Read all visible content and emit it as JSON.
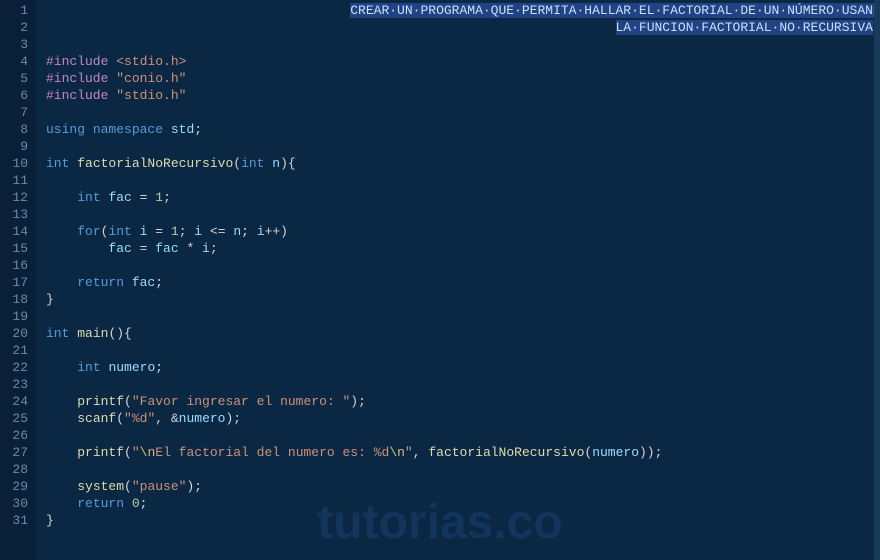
{
  "line_numbers": [
    "1",
    "2",
    "3",
    "4",
    "5",
    "6",
    "7",
    "8",
    "9",
    "10",
    "11",
    "12",
    "13",
    "14",
    "15",
    "16",
    "17",
    "18",
    "19",
    "20",
    "21",
    "22",
    "23",
    "24",
    "25",
    "26",
    "27",
    "28",
    "29",
    "30",
    "31"
  ],
  "comment": {
    "line1_prefix": "                                       ",
    "line1": "CREAR·UN·PROGRAMA·QUE·PERMITA·HALLAR·EL·FACTORIAL·DE·UN·NÚMERO·USANDO",
    "line2_prefix": "                                                                         ",
    "line2": "LA·FUNCION·FACTORIAL·NO·RECURSIVA"
  },
  "code": {
    "l4_inc": "#include",
    "l4_hdr": "<stdio.h>",
    "l5_inc": "#include",
    "l5_hdr": "\"conio.h\"",
    "l6_inc": "#include",
    "l6_hdr": "\"stdio.h\"",
    "l8_using": "using",
    "l8_ns": "namespace",
    "l8_std": "std",
    "l8_semi": ";",
    "l10_int": "int",
    "l10_fn": "factorialNoRecursivo",
    "l10_lp": "(",
    "l10_int2": "int",
    "l10_n": "n",
    "l10_rp": "){",
    "l12_indent": "    ",
    "l12_int": "int",
    "l12_fac": "fac",
    "l12_eq": " = ",
    "l12_one": "1",
    "l12_semi": ";",
    "l14_indent": "    ",
    "l14_for": "for",
    "l14_lp": "(",
    "l14_int": "int",
    "l14_i": "i",
    "l14_eq": " = ",
    "l14_one": "1",
    "l14_semi1": "; ",
    "l14_i2": "i",
    "l14_le": " <= ",
    "l14_n": "n",
    "l14_semi2": "; ",
    "l14_i3": "i",
    "l14_inc": "++)",
    "l15_indent": "        ",
    "l15_fac": "fac",
    "l15_eq": " = ",
    "l15_fac2": "fac",
    "l15_mul": " * ",
    "l15_i": "i",
    "l15_semi": ";",
    "l17_indent": "    ",
    "l17_ret": "return",
    "l17_fac": " fac",
    "l17_semi": ";",
    "l18_close": "}",
    "l20_int": "int",
    "l20_main": "main",
    "l20_paren": "(){",
    "l22_indent": "    ",
    "l22_int": "int",
    "l22_num": "numero",
    "l22_semi": ";",
    "l24_indent": "    ",
    "l24_printf": "printf",
    "l24_lp": "(",
    "l24_str": "\"Favor ingresar el numero: \"",
    "l24_rp": ");",
    "l25_indent": "    ",
    "l25_scanf": "scanf",
    "l25_lp": "(",
    "l25_str": "\"%d\"",
    "l25_comma": ", &",
    "l25_num": "numero",
    "l25_rp": ");",
    "l27_indent": "    ",
    "l27_printf": "printf",
    "l27_lp": "(",
    "l27_str1": "\"",
    "l27_esc1": "\\n",
    "l27_str2": "El factorial del numero es: %d",
    "l27_esc2": "\\n",
    "l27_str3": "\"",
    "l27_comma": ", ",
    "l27_fn": "factorialNoRecursivo",
    "l27_lp2": "(",
    "l27_num": "numero",
    "l27_rp": "));",
    "l29_indent": "    ",
    "l29_sys": "system",
    "l29_lp": "(",
    "l29_str": "\"pause\"",
    "l29_rp": ");",
    "l30_indent": "    ",
    "l30_ret": "return",
    "l30_zero": " 0",
    "l30_semi": ";",
    "l31_close": "}"
  },
  "watermark": "tutorias.co"
}
